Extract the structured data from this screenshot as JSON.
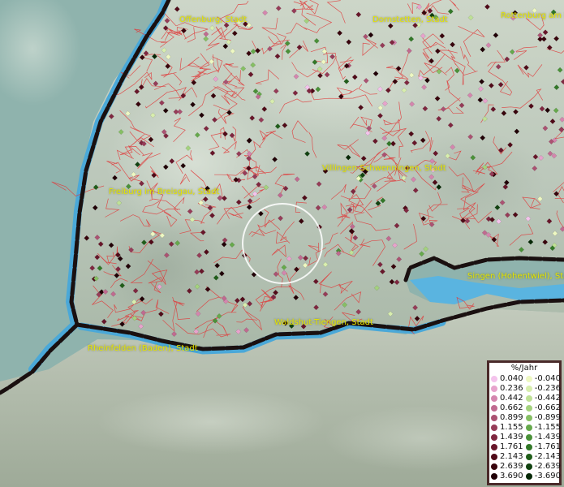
{
  "map": {
    "cities": [
      {
        "id": "offenburg",
        "label": "Offenburg, Stadt"
      },
      {
        "id": "dornstetten",
        "label": "Dornstetten, Stadt"
      },
      {
        "id": "rottenburg",
        "label": "Rottenburg am N"
      },
      {
        "id": "villingen",
        "label": "Villingen-Schwenningen, Stadt"
      },
      {
        "id": "freiburg",
        "label": "Freiburg im Breisgau, Stadt"
      },
      {
        "id": "singen",
        "label": "Singen (Hohentwiel), Stad"
      },
      {
        "id": "waldshut",
        "label": "Waldshut-Tiengen, Stadt"
      },
      {
        "id": "rheinfelden",
        "label": "Rheinfelden (Baden), Stadt"
      }
    ],
    "colors": {
      "water": "#4aa8d8",
      "border": "#1a1010",
      "admin_lines": "#e03a3a",
      "city_label": "#e6e600",
      "focus_ring": "#ffffff"
    }
  },
  "legend": {
    "title": "%/Jahr",
    "positive": [
      {
        "value": "0.040",
        "color": "#f4c3ec"
      },
      {
        "value": "0.236",
        "color": "#e7a3cc"
      },
      {
        "value": "0.442",
        "color": "#d486ae"
      },
      {
        "value": "0.662",
        "color": "#c06a90"
      },
      {
        "value": "0.899",
        "color": "#ab5272"
      },
      {
        "value": "1.155",
        "color": "#963c58"
      },
      {
        "value": "1.439",
        "color": "#7f2740"
      },
      {
        "value": "1.761",
        "color": "#68162a"
      },
      {
        "value": "2.143",
        "color": "#500a18"
      },
      {
        "value": "2.639",
        "color": "#38040c"
      },
      {
        "value": "3.690",
        "color": "#200006"
      }
    ],
    "negative": [
      {
        "value": "-0.040",
        "color": "#eef8c2"
      },
      {
        "value": "-0.236",
        "color": "#d8eeae"
      },
      {
        "value": "-0.442",
        "color": "#bfe196"
      },
      {
        "value": "-0.662",
        "color": "#a4d27e"
      },
      {
        "value": "-0.899",
        "color": "#86bf64"
      },
      {
        "value": "-1.155",
        "color": "#66a94c"
      },
      {
        "value": "-1.439",
        "color": "#4a9138"
      },
      {
        "value": "-1.761",
        "color": "#327828"
      },
      {
        "value": "-2.143",
        "color": "#205e1a"
      },
      {
        "value": "-2.639",
        "color": "#114210"
      },
      {
        "value": "-3.690",
        "color": "#062806"
      }
    ]
  }
}
